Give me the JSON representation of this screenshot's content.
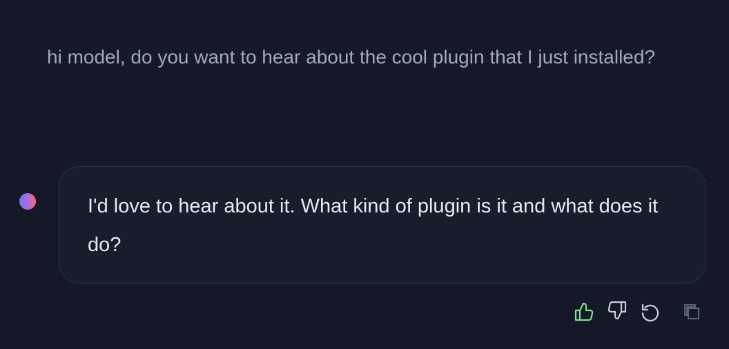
{
  "conversation": {
    "user_message": "hi model, do you want to hear about the cool plugin that I just installed?",
    "assistant_message": "I'd love to hear about it. What kind of plugin is it and what does it do?"
  },
  "actions": {
    "thumbs_up_icon": "thumbs-up-icon",
    "thumbs_down_icon": "thumbs-down-icon",
    "regenerate_icon": "refresh-icon",
    "copy_icon": "copy-icon"
  },
  "colors": {
    "background": "#151927",
    "user_text": "#a3a8b6",
    "assistant_bubble": "#181d2b",
    "assistant_text": "#e7e9ee",
    "thumbs_up_active": "#7fe08d",
    "action_icon": "#c9ced8",
    "disabled_icon": "#5c6270"
  }
}
